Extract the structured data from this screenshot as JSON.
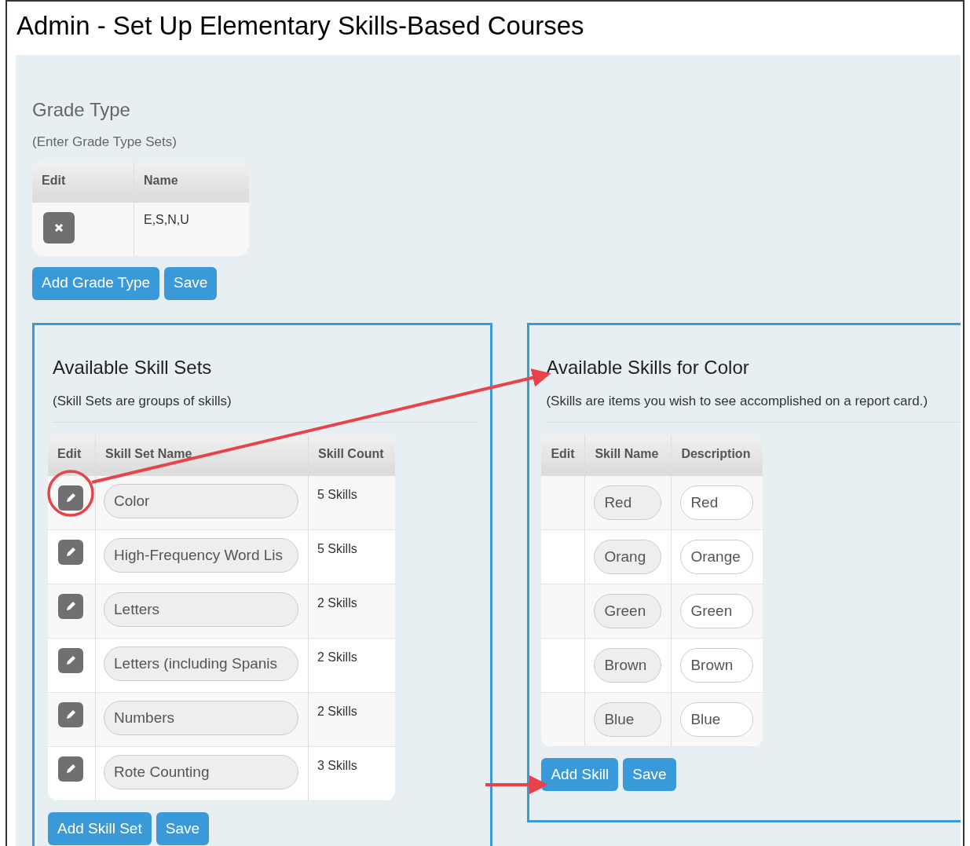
{
  "page_title": "Admin - Set Up Elementary Skills-Based Courses",
  "grade_type": {
    "title": "Grade Type",
    "subtitle": "(Enter Grade Type Sets)",
    "columns": [
      "Edit",
      "Name"
    ],
    "rows": [
      {
        "name": "E,S,N,U"
      }
    ],
    "buttons": [
      "Add Grade Type",
      "Save"
    ]
  },
  "skill_sets": {
    "title": "Available Skill Sets",
    "subtitle": "(Skill Sets are groups of skills)",
    "columns": [
      "Edit",
      "Skill Set Name",
      "Skill Count"
    ],
    "rows": [
      {
        "name": "Color",
        "count": "5 Skills",
        "highlighted": true
      },
      {
        "name": "High-Frequency Word Lis",
        "count": "5 Skills",
        "highlighted": false
      },
      {
        "name": "Letters",
        "count": "2 Skills",
        "highlighted": false
      },
      {
        "name": "Letters (including Spanis",
        "count": "2 Skills",
        "highlighted": false
      },
      {
        "name": "Numbers",
        "count": "2 Skills",
        "highlighted": false
      },
      {
        "name": "Rote Counting",
        "count": "3 Skills",
        "highlighted": false
      }
    ],
    "buttons": [
      "Add Skill Set",
      "Save"
    ]
  },
  "skills": {
    "title": "Available Skills for Color",
    "subtitle": "(Skills are items you wish to see accomplished on a report card.)",
    "columns": [
      "Edit",
      "Skill Name",
      "Description"
    ],
    "rows": [
      {
        "name": "Red",
        "description": "Red"
      },
      {
        "name": "Orang",
        "description": "Orange"
      },
      {
        "name": "Green",
        "description": "Green"
      },
      {
        "name": "Brown",
        "description": "Brown"
      },
      {
        "name": "Blue",
        "description": "Blue"
      }
    ],
    "buttons": [
      "Add Skill",
      "Save"
    ]
  }
}
